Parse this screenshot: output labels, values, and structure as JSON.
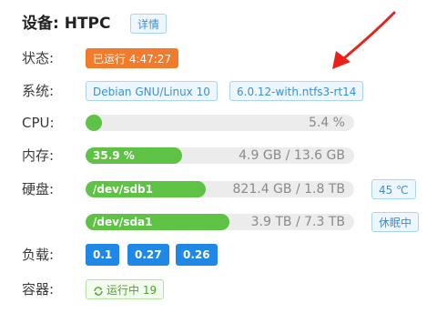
{
  "device": {
    "label": "设备:",
    "name": "HTPC",
    "details_button": "详情"
  },
  "status": {
    "label": "状态:",
    "value": "已运行 4:47:27"
  },
  "system": {
    "label": "系统:",
    "os": "Debian GNU/Linux 10",
    "kernel": "6.0.12-with.ntfs3-rt14"
  },
  "cpu": {
    "label": "CPU:",
    "percent": 5.4,
    "value_text": "5.4 %"
  },
  "memory": {
    "label": "内存:",
    "percent": 35.9,
    "fill_text": "35.9 %",
    "value_text": "4.9 GB / 13.6 GB"
  },
  "disk": {
    "label": "硬盘:",
    "disks": [
      {
        "name": "/dev/sdb1",
        "used_fraction": 0.446,
        "value_text": "821.4 GB / 1.8 TB",
        "badge": "45 ℃"
      },
      {
        "name": "/dev/sda1",
        "used_fraction": 0.534,
        "value_text": "3.9 TB / 7.3 TB",
        "badge": "休眠中"
      }
    ]
  },
  "load": {
    "label": "负载:",
    "values": [
      "0.1",
      "0.27",
      "0.26"
    ]
  },
  "containers": {
    "label": "容器:",
    "running_text": "运行中 19"
  },
  "colors": {
    "green": "#5ec244",
    "orange": "#f27b2b",
    "blue": "#1f87e5",
    "annotation_red": "#e8221b"
  }
}
